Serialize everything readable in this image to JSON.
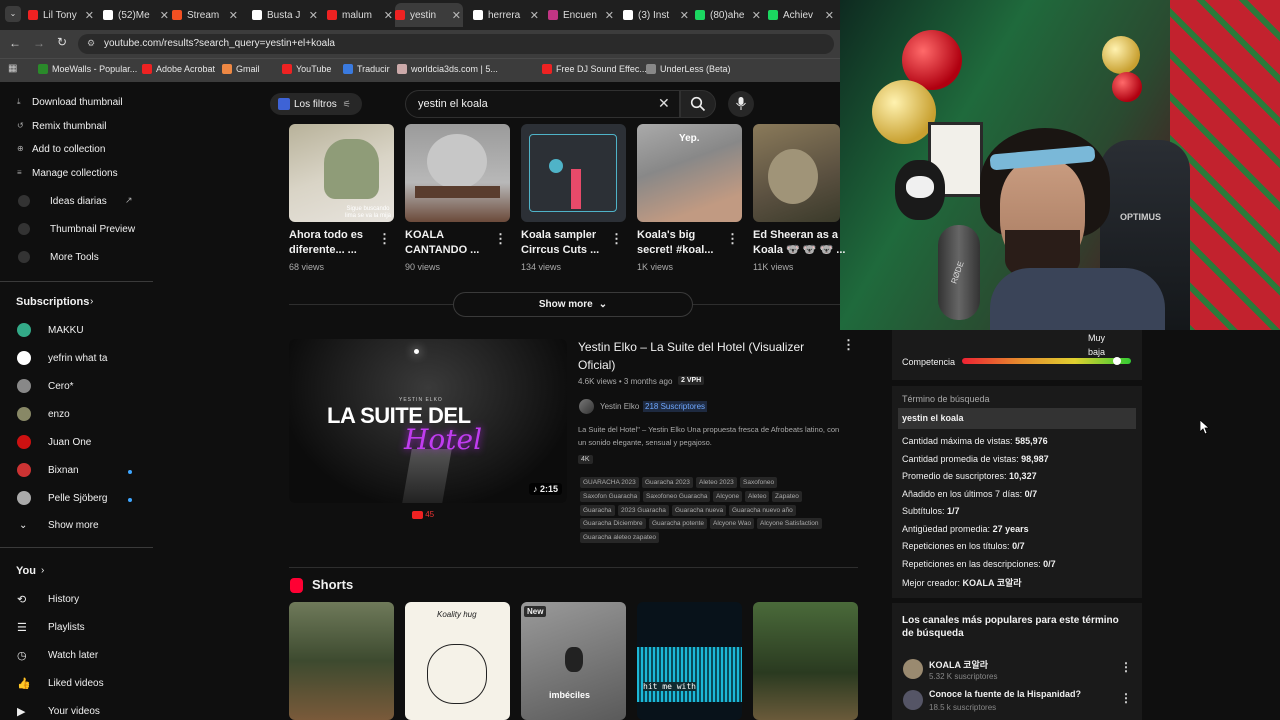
{
  "browser": {
    "tabs": [
      "Lil Tony",
      "(52)Me",
      "Stream",
      "Busta J",
      "malum",
      "yestin",
      "herrera",
      "Encuen",
      "(3) Inst",
      "(80)ahe",
      "Achiev"
    ],
    "url": "youtube.com/results?search_query=yestin+el+koala",
    "bookmarks": [
      "MoeWalls - Popular...",
      "Adobe Acrobat",
      "Gmail",
      "YouTube",
      "Traducir",
      "worldcia3ds.com | 5...",
      "Free DJ Sound Effec...",
      "UnderLess (Beta)"
    ]
  },
  "ext_menu": {
    "download": "Download thumbnail",
    "remix": "Remix thumbnail",
    "add": "Add to collection",
    "manage": "Manage collections",
    "ideas": "Ideas diarias",
    "preview": "Thumbnail Preview",
    "more": "More Tools"
  },
  "sidebar": {
    "subscriptions_title": "Subscriptions",
    "channels": [
      "MAKKU",
      "yefrin what ta",
      "Cero*",
      "enzo",
      "Juan One",
      "Bixnan",
      "Pelle Sjöberg"
    ],
    "show_more": "Show more",
    "you_title": "You",
    "you_items": [
      "History",
      "Playlists",
      "Watch later",
      "Liked videos",
      "Your videos"
    ]
  },
  "search": {
    "filters": "Los filtros",
    "query": "yestin el koala"
  },
  "top_videos": [
    {
      "title1": "Ahora todo es",
      "title2": "diferente... ...",
      "views": "68 views"
    },
    {
      "title1": "KOALA",
      "title2": "CANTANDO ...",
      "views": "90 views"
    },
    {
      "title1": "Koala sampler",
      "title2": "Cirrcus Cuts ...",
      "views": "134 views"
    },
    {
      "title1": "Koala's big",
      "title2": "secret!   #koal...",
      "views": "1K views"
    },
    {
      "title1": "Ed Sheeran as a",
      "title2": "Koala 🐨 🐨 🐨 ...",
      "views": "11K views"
    }
  ],
  "thumb_texts": {
    "t1": "Sigue buscando lima se va la mija",
    "t4": "Yep."
  },
  "show_more": "Show more",
  "main_video": {
    "title1": "Yestin Elko – La Suite del Hotel (Visualizer",
    "title2": "Oficial)",
    "meta": "4.6K views • 3 months ago",
    "vph": "2 VPH",
    "channel": "Yestin Elko",
    "subs": "218 Suscriptores",
    "desc1": "La Suite del Hotel\" – Yestin Elko Una propuesta fresca de Afrobeats latino, con",
    "desc2": "un sonido elegante, sensual y pegajoso.",
    "badge": "4K",
    "duration": "2:15",
    "likes": "45",
    "thumb_artist": "YESTIN ELKO",
    "thumb_title": "LA SUITE DEL",
    "thumb_script": "Hotel",
    "tags": [
      "GUARACHA 2023",
      "Guaracha 2023",
      "Aleteo 2023",
      "Saxofoneo",
      "Saxofon Guaracha",
      "Saxofoneo Guaracha",
      "Alcyone",
      "Aleteo",
      "Zapateo",
      "Guaracha",
      "2023 Guaracha",
      "Guaracha nueva",
      "Guaracha nuevo año",
      "Guaracha Diciembre",
      "Guaracha potente",
      "Alcyone Wao",
      "Alcyone Satisfaction",
      "Guaracha aleteo zapateo"
    ]
  },
  "shorts": {
    "title": "Shorts",
    "s2": "Koality hug",
    "s3_badge": "New",
    "s3_caption": "imbéciles",
    "s4_caption": "hit me with"
  },
  "panel": {
    "competition_label": "Competencia",
    "competition_level_1": "Muy",
    "competition_level_2": "baja",
    "competition_level": 0.92,
    "term_label": "Término de búsqueda",
    "term": "yestin el koala",
    "stats": [
      {
        "k": "Cantidad máxima de vistas: ",
        "v": "585,976"
      },
      {
        "k": "Cantidad promedia de vistas: ",
        "v": "98,987"
      },
      {
        "k": "Promedio de suscriptores: ",
        "v": "10,327"
      },
      {
        "k": "Añadido en los últimos 7 días: ",
        "v": "0/7"
      },
      {
        "k": "Subtítulos: ",
        "v": "1/7"
      },
      {
        "k": "Antigüedad promedia: ",
        "v": "27 years"
      },
      {
        "k": "Repeticiones en los títulos: ",
        "v": "0/7"
      },
      {
        "k": "Repeticiones en las descripciones: ",
        "v": "0/7"
      },
      {
        "k": "Mejor creador: ",
        "v": "KOALA 코알라"
      }
    ],
    "popular_title1": "Los canales más populares para este término",
    "popular_title2": "de búsqueda",
    "popular": [
      {
        "name": "KOALA 코알라",
        "subs": "5.32 K suscriptores"
      },
      {
        "name": "Conoce la fuente de la Hispanidad?",
        "subs": "18.5 k suscriptores"
      }
    ]
  },
  "webcam": {
    "mic_brand": "RØDE",
    "chair_brand": "OPTIMUS"
  }
}
